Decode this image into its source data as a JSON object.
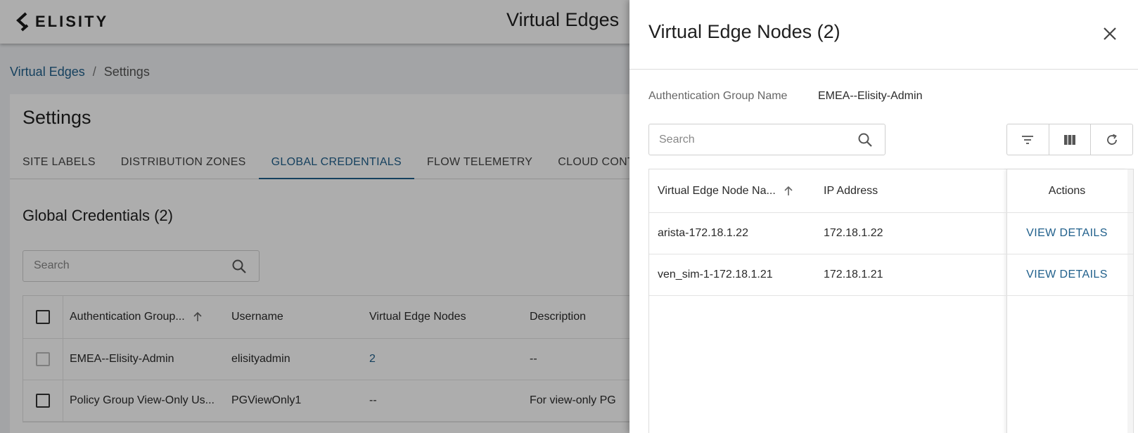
{
  "app": {
    "logo_text": "ELISITY",
    "title": "Virtual Edges"
  },
  "breadcrumb": {
    "parent": "Virtual Edges",
    "separator": "/",
    "current": "Settings"
  },
  "settings": {
    "title": "Settings",
    "tabs": [
      {
        "label": "SITE LABELS"
      },
      {
        "label": "DISTRIBUTION ZONES"
      },
      {
        "label": "GLOBAL CREDENTIALS",
        "active": true
      },
      {
        "label": "FLOW TELEMETRY"
      },
      {
        "label": "CLOUD CONTRO"
      }
    ],
    "section_title": "Global Credentials (2)",
    "search_placeholder": "Search",
    "table": {
      "headers": {
        "auth_group": "Authentication Group...",
        "username": "Username",
        "ve_nodes": "Virtual Edge Nodes",
        "description": "Description"
      },
      "rows": [
        {
          "auth_group": "EMEA--Elisity-Admin",
          "username": "elisityadmin",
          "ve_nodes": "2",
          "description": "--"
        },
        {
          "auth_group": "Policy Group View-Only Us...",
          "username": "PGViewOnly1",
          "ve_nodes": "--",
          "description": "For view-only PG"
        }
      ]
    }
  },
  "drawer": {
    "title": "Virtual Edge Nodes (2)",
    "info_label": "Authentication Group Name",
    "info_value": "EMEA--Elisity-Admin",
    "search_placeholder": "Search",
    "table": {
      "headers": {
        "name": "Virtual Edge Node Na...",
        "ip": "IP Address",
        "actions": "Actions"
      },
      "rows": [
        {
          "name": "arista-172.18.1.22",
          "ip": "172.18.1.22",
          "action": "VIEW DETAILS"
        },
        {
          "name": "ven_sim-1-172.18.1.21",
          "ip": "172.18.1.21",
          "action": "VIEW DETAILS"
        }
      ]
    }
  },
  "colors": {
    "accent": "#1f5f8b",
    "overlay": "rgba(0,0,0,0.32)"
  },
  "icons": [
    "elisity-logo-icon",
    "search-icon",
    "sort-up-icon",
    "close-icon",
    "filter-icon",
    "columns-icon",
    "refresh-icon"
  ]
}
